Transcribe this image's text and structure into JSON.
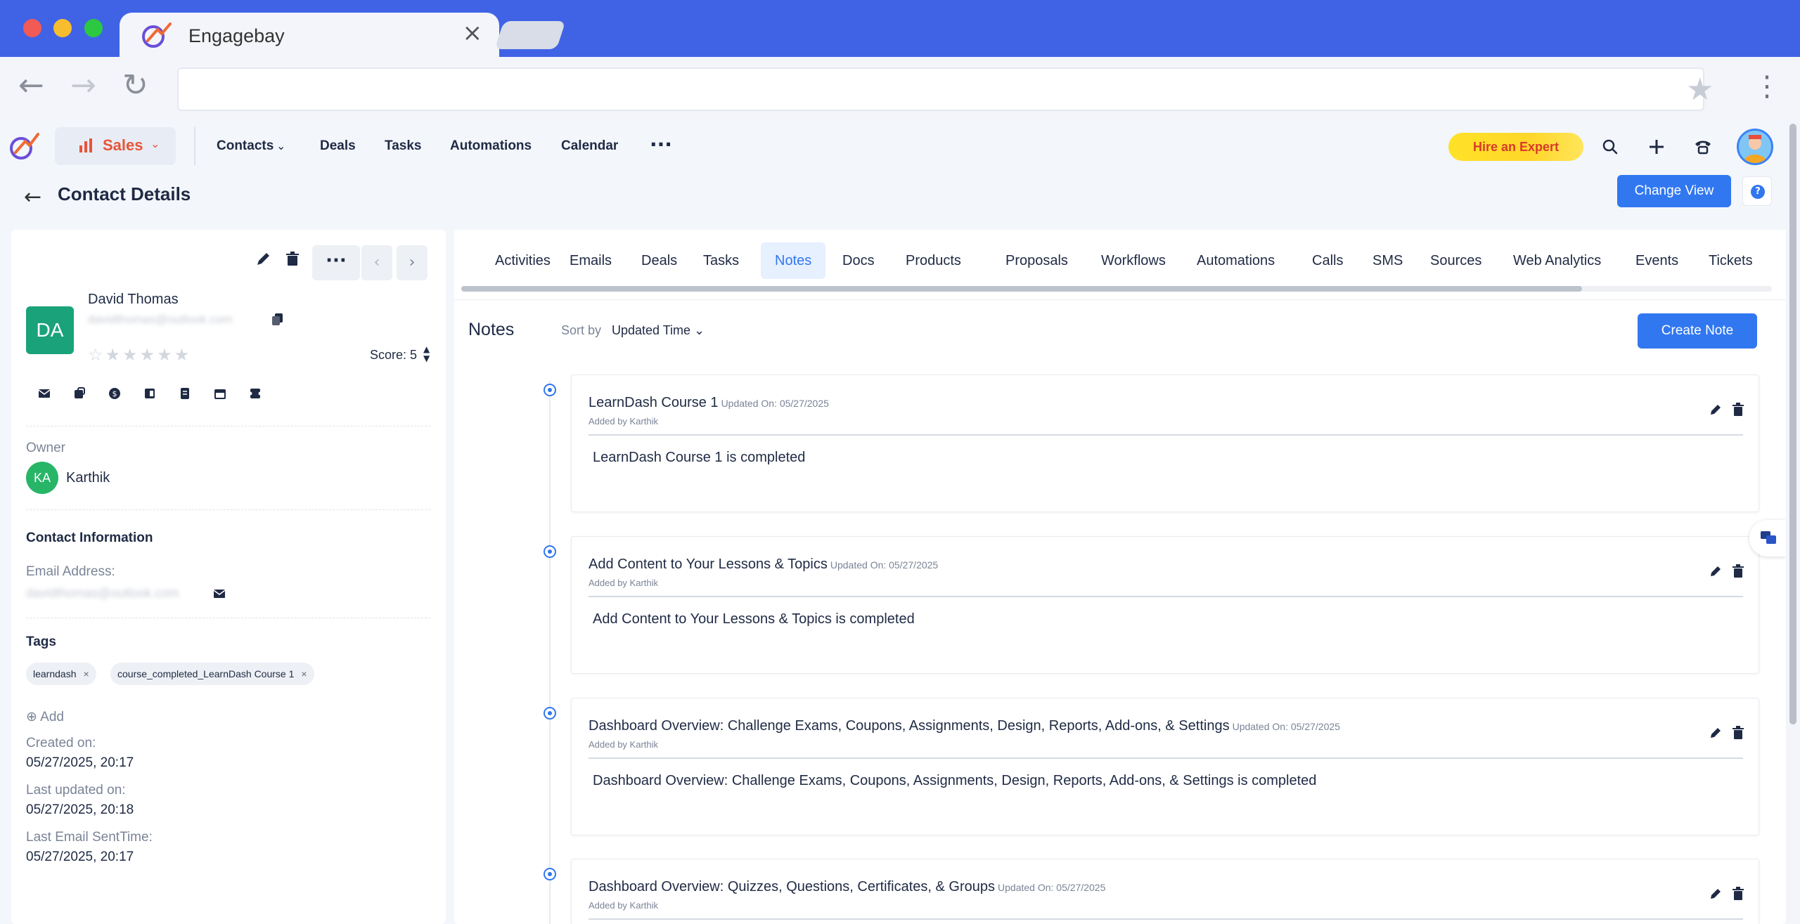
{
  "browser": {
    "tab_title": "Engagebay",
    "tab_close": "×",
    "back": "←",
    "forward": "→",
    "reload": "↻",
    "star": "★",
    "menu": "⋮"
  },
  "header": {
    "module": "Sales",
    "nav": [
      "Contacts",
      "Deals",
      "Tasks",
      "Automations",
      "Calendar"
    ],
    "more": "···",
    "hire_expert": "Hire an Expert"
  },
  "sub_header": {
    "title": "Contact Details",
    "change_view": "Change View",
    "help": "?"
  },
  "contact": {
    "initials": "DA",
    "name": "David Thomas",
    "email": "davidthomas@outlook.com",
    "stars": "☆★★★★★",
    "score_label": "Score: 5",
    "more": "···",
    "prev": "‹",
    "next": "›",
    "owner_label": "Owner",
    "owner_initials": "KA",
    "owner_name": "Karthik",
    "contact_info_label": "Contact Information",
    "email_label": "Email Address:",
    "tags_label": "Tags",
    "tags": [
      "learndash",
      "course_completed_LearnDash Course 1"
    ],
    "tag_remove": "×",
    "add_label": "⊕ Add",
    "created_label": "Created on:",
    "created_value": "05/27/2025, 20:17",
    "updated_label": "Last updated on:",
    "updated_value": "05/27/2025, 20:18",
    "last_email_label": "Last Email SentTime:",
    "last_email_value": "05/27/2025, 20:17"
  },
  "tabs": [
    "Activities",
    "Emails",
    "Deals",
    "Tasks",
    "Notes",
    "Docs",
    "Products",
    "Proposals",
    "Workflows",
    "Automations",
    "Calls",
    "SMS",
    "Sources",
    "Web Analytics",
    "Events",
    "Tickets"
  ],
  "active_tab": "Notes",
  "notes": {
    "title": "Notes",
    "sort_label": "Sort by",
    "sort_value": "Updated Time ⌄",
    "create_button": "Create Note",
    "items": [
      {
        "title": "LearnDash Course 1",
        "updated": "Updated On: 05/27/2025",
        "added_by": "Added by Karthik",
        "body": "LearnDash Course 1 is completed"
      },
      {
        "title": "Add Content to Your Lessons & Topics",
        "updated": "Updated On: 05/27/2025",
        "added_by": "Added by Karthik",
        "body": "Add Content to Your Lessons & Topics is completed"
      },
      {
        "title": "Dashboard Overview: Challenge Exams, Coupons, Assignments, Design, Reports, Add-ons, & Settings",
        "updated": "Updated On: 05/27/2025",
        "added_by": "Added by Karthik",
        "body": "Dashboard Overview: Challenge Exams, Coupons, Assignments, Design, Reports, Add-ons, & Settings is completed"
      },
      {
        "title": "Dashboard Overview: Quizzes, Questions, Certificates, & Groups",
        "updated": "Updated On: 05/27/2025",
        "added_by": "Added by Karthik",
        "body": ""
      }
    ]
  },
  "colors": {
    "browser_chrome": "#4063e6",
    "primary": "#3177f0",
    "sales_accent": "#e8553a",
    "avatar_contact": "#1aa37a",
    "avatar_owner": "#27b567",
    "hire_bg": "#ffe227",
    "hire_text": "#d93a2b"
  }
}
